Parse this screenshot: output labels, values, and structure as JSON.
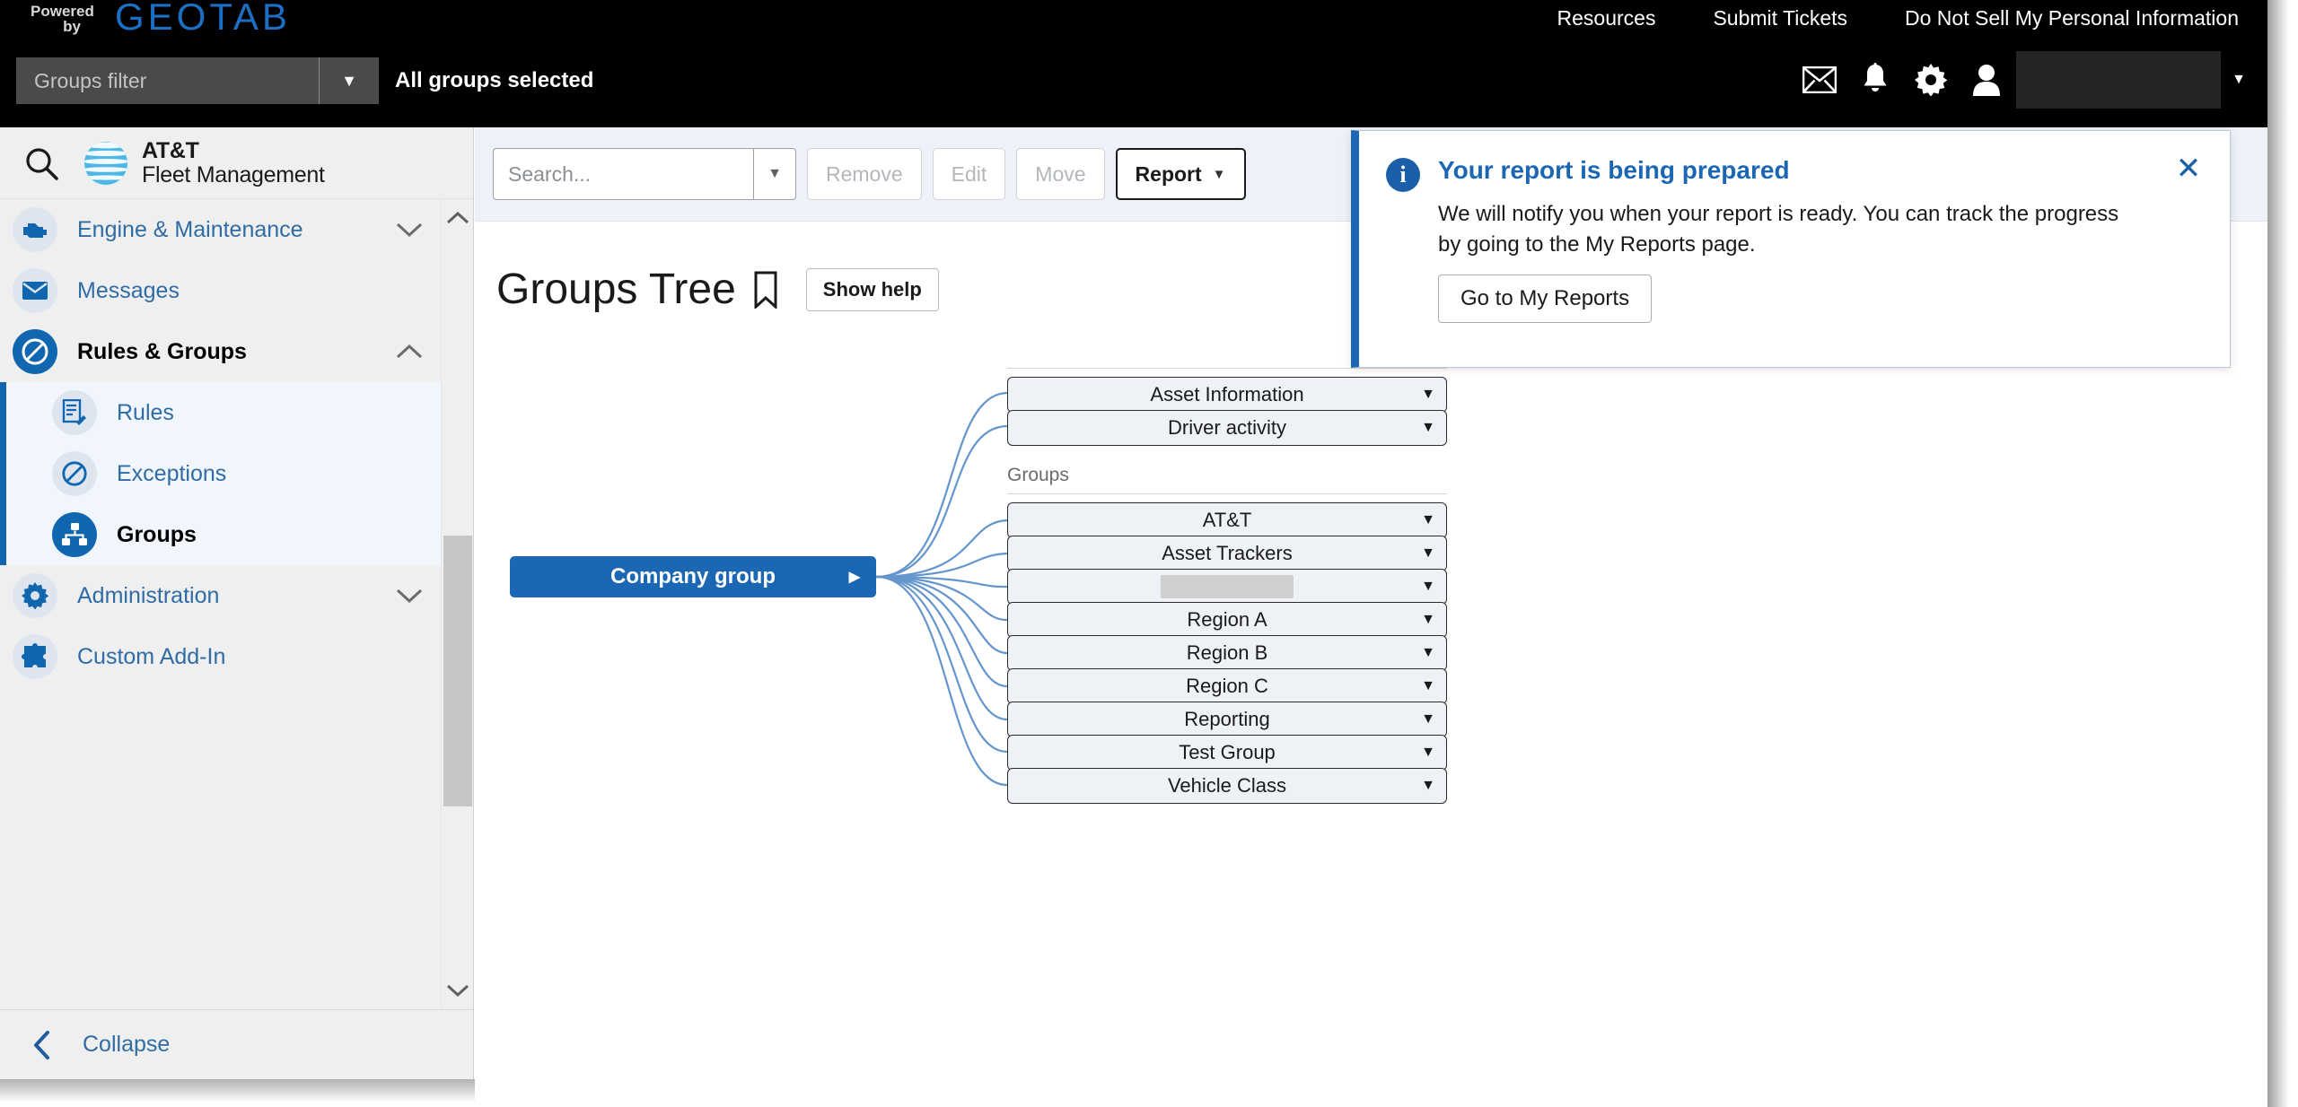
{
  "topbar": {
    "powered_line1": "Powered",
    "powered_line2": "by",
    "brand": "GEOTAB",
    "brand_color": "#1b6fc4",
    "nav_links": [
      {
        "label": "Resources"
      },
      {
        "label": "Submit Tickets"
      },
      {
        "label": "Do Not Sell My Personal Information"
      }
    ],
    "groups_filter_placeholder": "Groups filter",
    "groups_filter_value": "",
    "all_groups_status": "All groups selected",
    "icons": [
      {
        "name": "mail-icon"
      },
      {
        "name": "bell-icon"
      },
      {
        "name": "gear-icon"
      },
      {
        "name": "user-icon"
      }
    ],
    "user_name_redacted": ""
  },
  "sidebar": {
    "product_name_line1": "AT&T",
    "product_name_line2": "Fleet Management",
    "search_icon": "search-icon",
    "items": [
      {
        "label": "Engine & Maintenance",
        "icon": "engine-icon",
        "state": "collapsed",
        "level": "top",
        "chevron": "down"
      },
      {
        "label": "Messages",
        "icon": "mail-icon",
        "state": "none",
        "level": "top",
        "chevron": ""
      },
      {
        "label": "Rules & Groups",
        "icon": "rules-icon",
        "state": "expanded",
        "level": "top",
        "chevron": "up",
        "selected_parent": true
      },
      {
        "label": "Rules",
        "icon": "rules-doc-icon",
        "level": "sub"
      },
      {
        "label": "Exceptions",
        "icon": "exceptions-icon",
        "level": "sub"
      },
      {
        "label": "Groups",
        "icon": "groups-icon",
        "level": "sub",
        "active": true
      },
      {
        "label": "Administration",
        "icon": "gear-icon",
        "state": "collapsed",
        "level": "top",
        "chevron": "down"
      },
      {
        "label": "Custom Add-In",
        "icon": "puzzle-icon",
        "state": "none",
        "level": "top",
        "chevron": ""
      }
    ],
    "collapse_label": "Collapse",
    "accent_color": "#1166b0",
    "link_color": "#2f6ca5"
  },
  "toolbar": {
    "search_placeholder": "Search...",
    "search_value": "",
    "remove_label": "Remove",
    "edit_label": "Edit",
    "move_label": "Move",
    "report_label": "Report"
  },
  "page": {
    "title": "Groups Tree",
    "bookmark_icon": "bookmark-icon",
    "show_help_label": "Show help"
  },
  "toast": {
    "icon": "info-icon",
    "title": "Your report is being prepared",
    "body": "We will notify you when your report is ready. You can track the progress by going to the My Reports page.",
    "button_label": "Go to My Reports",
    "close_icon": "close-icon",
    "accent_color": "#1b67b3"
  },
  "tree": {
    "root": {
      "label": "Company group",
      "expand_arrow": "▶",
      "color": "#1b67b3"
    },
    "sections": [
      {
        "label": "",
        "index": 0
      },
      {
        "label": "Groups",
        "index": 1
      }
    ],
    "nodes": [
      {
        "label": "Asset Information",
        "section": 0,
        "caret": "▼",
        "redacted": false
      },
      {
        "label": "Driver activity",
        "section": 0,
        "caret": "▼",
        "redacted": false
      },
      {
        "label": "AT&T",
        "section": 1,
        "caret": "▼",
        "redacted": false
      },
      {
        "label": "Asset Trackers",
        "section": 1,
        "caret": "▼",
        "redacted": false
      },
      {
        "label": "",
        "section": 1,
        "caret": "▼",
        "redacted": true
      },
      {
        "label": "Region A",
        "section": 1,
        "caret": "▼",
        "redacted": false
      },
      {
        "label": "Region B",
        "section": 1,
        "caret": "▼",
        "redacted": false
      },
      {
        "label": "Region C",
        "section": 1,
        "caret": "▼",
        "redacted": false
      },
      {
        "label": "Reporting",
        "section": 1,
        "caret": "▼",
        "redacted": false
      },
      {
        "label": "Test Group",
        "section": 1,
        "caret": "▼",
        "redacted": false
      },
      {
        "label": "Vehicle Class",
        "section": 1,
        "caret": "▼",
        "redacted": false
      }
    ]
  }
}
